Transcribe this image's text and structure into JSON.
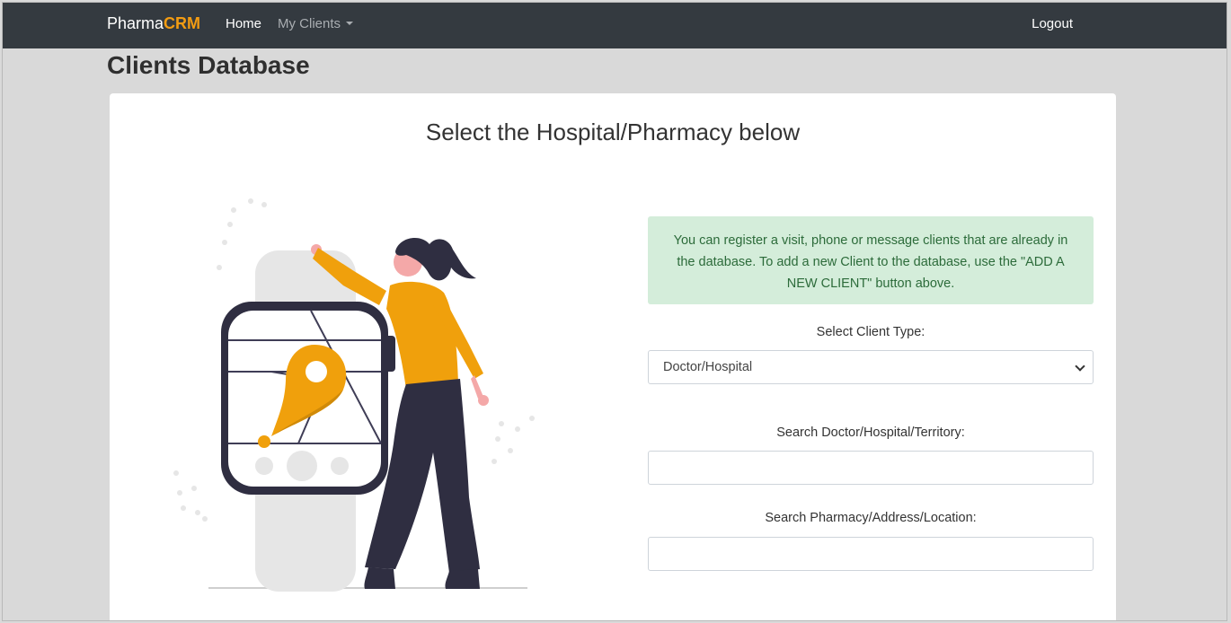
{
  "navbar": {
    "brand_main": "Pharma",
    "brand_accent": "CRM",
    "home": "Home",
    "my_clients": "My Clients",
    "logout": "Logout"
  },
  "page": {
    "title": "Clients Database"
  },
  "card": {
    "title": "Select the Hospital/Pharmacy below",
    "alert": "You can register a visit, phone or message clients that are already in the database. To add a new Client to the database, use the \"ADD A NEW CLIENT\" button above.",
    "client_type_label": "Select Client Type:",
    "client_type_value": "Doctor/Hospital",
    "search_doctor_label": "Search Doctor/Hospital/Territory:",
    "search_doctor_value": "",
    "search_pharmacy_label": "Search Pharmacy/Address/Location:",
    "search_pharmacy_value": ""
  },
  "colors": {
    "navbar_bg": "#343a40",
    "brand_accent": "#f39c12",
    "alert_bg": "#d4edda",
    "illustration_accent": "#f0a00c",
    "illustration_dark": "#2f2e41"
  }
}
